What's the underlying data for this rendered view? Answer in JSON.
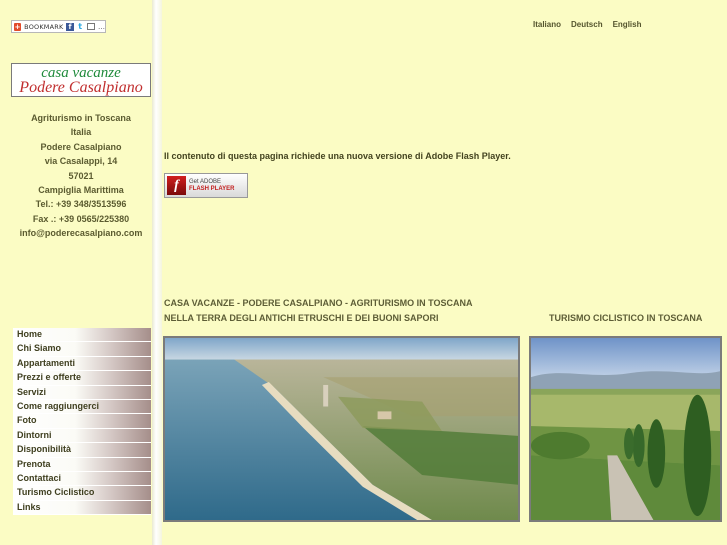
{
  "sharebar": {
    "bookmark_label": "BOOKMARK",
    "plus_glyph": "+",
    "facebook_glyph": "f",
    "twitter_glyph": "t",
    "more_glyph": "…"
  },
  "logo": {
    "line1": "casa vacanze",
    "line2": "Podere Casalpiano"
  },
  "address": {
    "lines": [
      "Agriturismo in Toscana",
      "Italia",
      "Podere Casalpiano",
      "via Casalappi, 14",
      "57021",
      "Campiglia Marittima",
      "Tel.: +39 348/3513596",
      "Fax .: +39 0565/225380",
      "info@poderecasalpiano.com"
    ]
  },
  "menu": {
    "items": [
      "Home",
      "Chi Siamo",
      "Appartamenti",
      "Prezzi e offerte",
      "Servizi",
      "Come raggiungerci",
      "Foto",
      "Dintorni",
      "Disponibilità",
      "Prenota",
      "Contattaci",
      "Turismo Ciclistico",
      "Links"
    ]
  },
  "languages": [
    "Italiano",
    "Deutsch",
    "English"
  ],
  "flash": {
    "message": "Il contenuto di questa pagina richiede una nuova versione di Adobe Flash Player.",
    "badge_icon": "f",
    "badge_line1": "Get ADOBE",
    "badge_line2": "FLASH PLAYER"
  },
  "main": {
    "headline1": "CASA VACANZE - PODERE CASALPIANO - AGRITURISMO IN TOSCANA",
    "headline2": "NELLA TERRA DEGLI ANTICHI ETRUSCHI E DEI BUONI SAPORI",
    "headline3": "TURISMO CICLISTICO IN TOSCANA"
  },
  "colors": {
    "page_background": "#fbfcc4",
    "text": "#5a5a33",
    "logo_green": "#1e8a3a",
    "logo_red": "#c12f2f"
  },
  "icons": [
    "bookmark-plus-icon",
    "facebook-icon",
    "twitter-icon",
    "email-icon",
    "adobe-flash-icon"
  ]
}
